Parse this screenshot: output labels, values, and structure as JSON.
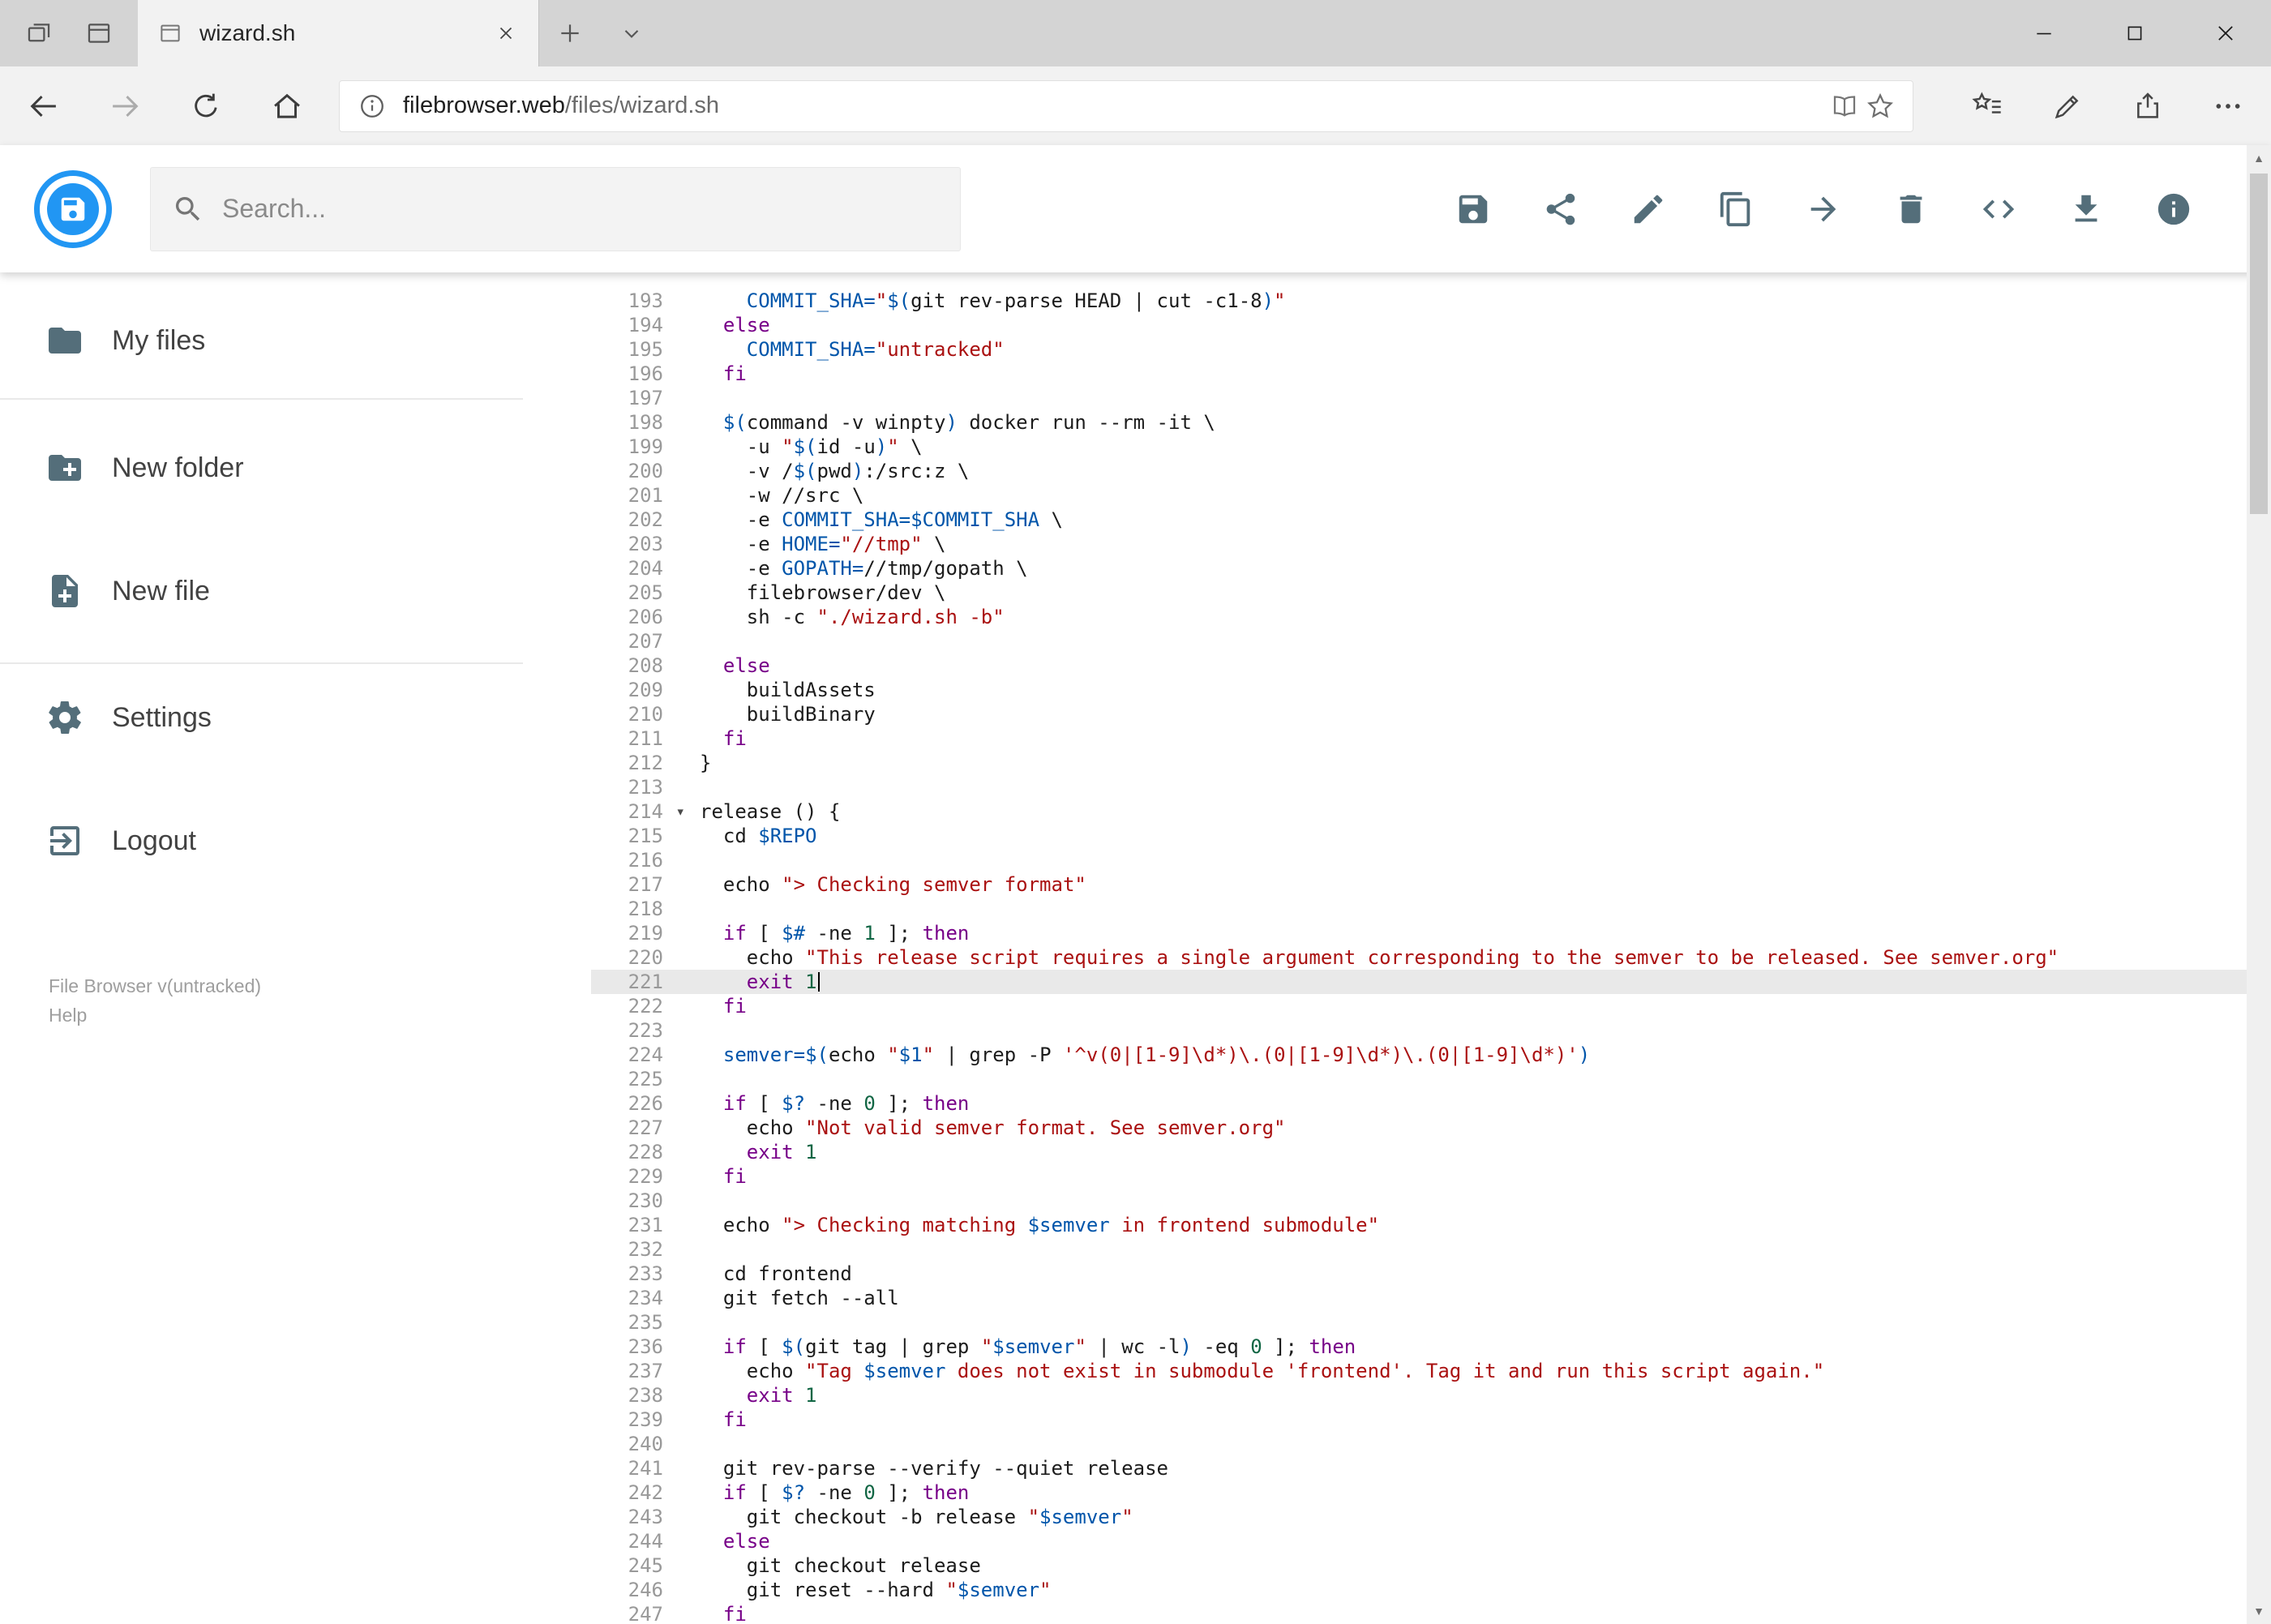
{
  "browser": {
    "tab_title": "wizard.sh",
    "url_host": "filebrowser.web",
    "url_path": "/files/wizard.sh"
  },
  "header": {
    "search_placeholder": "Search...",
    "action_icons": [
      "save",
      "share",
      "rename",
      "copy",
      "move",
      "delete",
      "raw-code",
      "download",
      "info"
    ]
  },
  "sidebar": {
    "items": [
      {
        "label": "My files",
        "icon": "folder-icon"
      },
      {
        "label": "New folder",
        "icon": "new-folder-icon"
      },
      {
        "label": "New file",
        "icon": "new-file-icon"
      },
      {
        "label": "Settings",
        "icon": "settings-icon"
      },
      {
        "label": "Logout",
        "icon": "logout-icon"
      }
    ],
    "version": "File Browser v(untracked)",
    "help": "Help"
  },
  "editor": {
    "language": "shell",
    "first_line_number": 193,
    "active_line": 221,
    "folded_marker_line": 214,
    "lines": [
      "    COMMIT_SHA=\"$(git rev-parse HEAD | cut -c1-8)\"",
      "  else",
      "    COMMIT_SHA=\"untracked\"",
      "  fi",
      "",
      "  $(command -v winpty) docker run --rm -it \\",
      "    -u \"$(id -u)\" \\",
      "    -v /$(pwd):/src:z \\",
      "    -w //src \\",
      "    -e COMMIT_SHA=$COMMIT_SHA \\",
      "    -e HOME=\"//tmp\" \\",
      "    -e GOPATH=//tmp/gopath \\",
      "    filebrowser/dev \\",
      "    sh -c \"./wizard.sh -b\"",
      "",
      "  else",
      "    buildAssets",
      "    buildBinary",
      "  fi",
      "}",
      "",
      "release () {",
      "  cd $REPO",
      "",
      "  echo \"> Checking semver format\"",
      "",
      "  if [ $# -ne 1 ]; then",
      "    echo \"This release script requires a single argument corresponding to the semver to be released. See semver.org\"",
      "    exit 1",
      "  fi",
      "",
      "  semver=$(echo \"$1\" | grep -P '^v(0|[1-9]\\d*)\\.(0|[1-9]\\d*)\\.(0|[1-9]\\d*)')",
      "",
      "  if [ $? -ne 0 ]; then",
      "    echo \"Not valid semver format. See semver.org\"",
      "    exit 1",
      "  fi",
      "",
      "  echo \"> Checking matching $semver in frontend submodule\"",
      "",
      "  cd frontend",
      "  git fetch --all",
      "",
      "  if [ $(git tag | grep \"$semver\" | wc -l) -eq 0 ]; then",
      "    echo \"Tag $semver does not exist in submodule 'frontend'. Tag it and run this script again.\"",
      "    exit 1",
      "  fi",
      "",
      "  git rev-parse --verify --quiet release",
      "  if [ $? -ne 0 ]; then",
      "    git checkout -b release \"$semver\"",
      "  else",
      "    git checkout release",
      "    git reset --hard \"$semver\"",
      "  fi"
    ]
  },
  "colors": {
    "accent": "#2196f3",
    "icon_gray": "#546e7a",
    "syntax_keyword": "#770088",
    "syntax_string": "#aa1111",
    "syntax_variable": "#0055aa",
    "syntax_number": "#116644",
    "active_line_bg": "#e9e9e9"
  }
}
